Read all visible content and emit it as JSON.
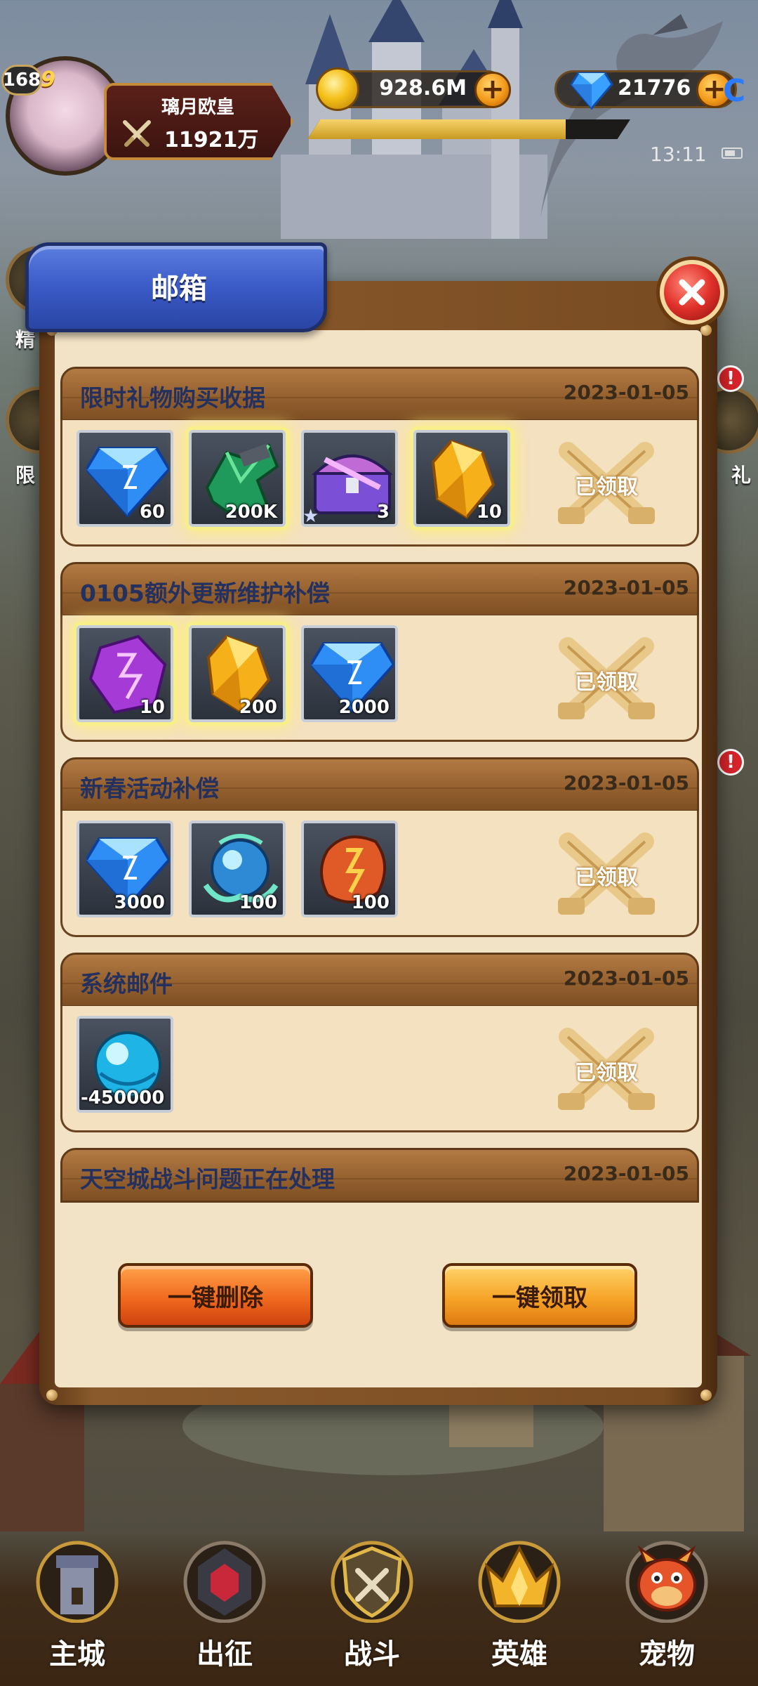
{
  "hud": {
    "level": "168",
    "vip": "9",
    "player_name": "璃月欧皇",
    "power": "11921万",
    "gold": "928.6M",
    "gems": "21776",
    "exp_progress": 0.8,
    "time": "13:11",
    "corner_mark": "C"
  },
  "side": {
    "left_label_1": "精",
    "left_label_2": "限",
    "right_label": "礼",
    "badge": "!"
  },
  "dialog": {
    "title": "邮箱",
    "claimed_label": "已领取",
    "mails": [
      {
        "title": "限时礼物购买收据",
        "date": "2023-01-05",
        "items": [
          {
            "icon": "blue-diamond-icon",
            "qty": "60"
          },
          {
            "icon": "green-material-icon",
            "qty": "200K"
          },
          {
            "icon": "treasure-chest-icon",
            "qty": "3"
          },
          {
            "icon": "gold-crystal-icon",
            "qty": "10"
          }
        ]
      },
      {
        "title": "0105额外更新维护补偿",
        "date": "2023-01-05",
        "items": [
          {
            "icon": "purple-crystal-icon",
            "qty": "10"
          },
          {
            "icon": "gold-crystal-icon",
            "qty": "200"
          },
          {
            "icon": "blue-diamond-icon",
            "qty": "2000"
          }
        ]
      },
      {
        "title": "新春活动补偿",
        "date": "2023-01-05",
        "items": [
          {
            "icon": "blue-diamond-icon",
            "qty": "3000"
          },
          {
            "icon": "spirit-orb-icon",
            "qty": "100"
          },
          {
            "icon": "rune-stone-icon",
            "qty": "100"
          }
        ]
      },
      {
        "title": "系统邮件",
        "date": "2023-01-05",
        "items": [
          {
            "icon": "cyan-orb-icon",
            "qty": "-450000"
          }
        ]
      },
      {
        "title": "天空城战斗问题正在处理",
        "date": "2023-01-05"
      }
    ],
    "delete_all": "一键删除",
    "claim_all": "一键领取"
  },
  "nav": [
    {
      "label": "主城",
      "icon": "castle-tower-icon"
    },
    {
      "label": "出征",
      "icon": "expedition-icon"
    },
    {
      "label": "战斗",
      "icon": "battle-shield-icon"
    },
    {
      "label": "英雄",
      "icon": "hero-crown-icon"
    },
    {
      "label": "宠物",
      "icon": "pet-dragon-icon"
    }
  ]
}
